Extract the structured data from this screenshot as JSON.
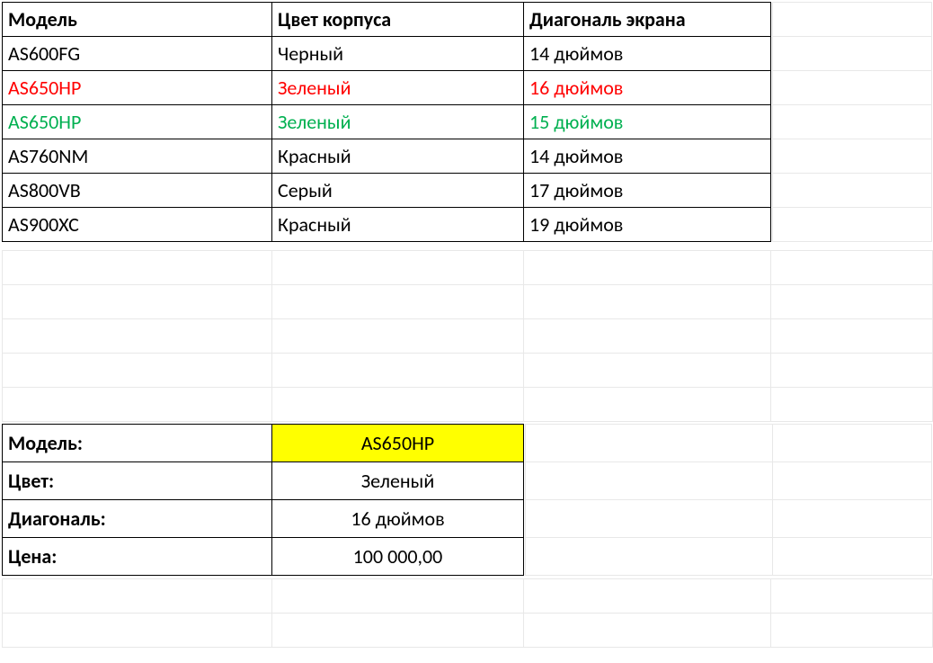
{
  "table": {
    "headers": {
      "model": "Модель",
      "color": "Цвет корпуса",
      "diagonal": "Диагональ экрана"
    },
    "rows": [
      {
        "model": "AS600FG",
        "color": "Черный",
        "diagonal": "14 дюймов",
        "style": "normal"
      },
      {
        "model": "AS650HP",
        "color": "Зеленый",
        "diagonal": "16 дюймов",
        "style": "red"
      },
      {
        "model": "AS650HP",
        "color": "Зеленый",
        "diagonal": "15 дюймов",
        "style": "green"
      },
      {
        "model": "AS760NM",
        "color": "Красный",
        "diagonal": "14 дюймов",
        "style": "normal"
      },
      {
        "model": "AS800VB",
        "color": "Серый",
        "diagonal": "17 дюймов",
        "style": "normal"
      },
      {
        "model": "AS900XC",
        "color": "Красный",
        "diagonal": "19 дюймов",
        "style": "normal"
      }
    ]
  },
  "details": {
    "labels": {
      "model": "Модель:",
      "color": "Цвет:",
      "diagonal": "Диагональ:",
      "price": "Цена:"
    },
    "values": {
      "model": "AS650HP",
      "color": "Зеленый",
      "diagonal": "16 дюймов",
      "price": "100 000,00"
    }
  }
}
